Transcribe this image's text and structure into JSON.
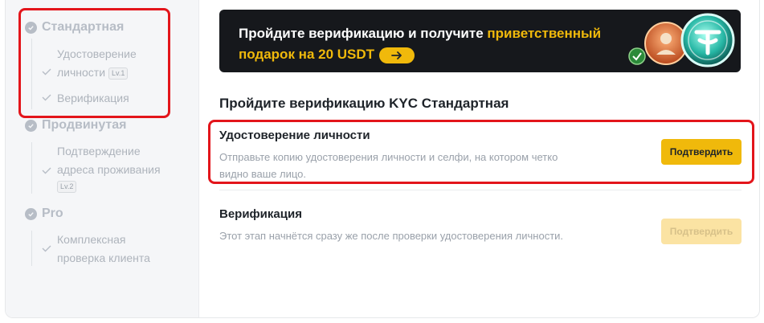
{
  "sidebar": {
    "levels": [
      {
        "label": "Стандартная",
        "steps": [
          {
            "label_line1": "Удостоверение",
            "label_line2": "личности",
            "badge": "Lv.1"
          },
          {
            "label_line1": "Верификация"
          }
        ]
      },
      {
        "label": "Продвинутая",
        "steps": [
          {
            "label_line1": "Подтверждение",
            "label_line2": "адреса проживания",
            "badge": "Lv.2"
          }
        ]
      },
      {
        "label": "Pro",
        "steps": [
          {
            "label_line1": "Комплексная",
            "label_line2": "проверка клиента"
          }
        ]
      }
    ]
  },
  "banner": {
    "text_part1": "Пройдите верификацию и получите ",
    "text_highlight": "приветственный подарок на 20 USDT",
    "arrow_icon": "arrow-right-icon"
  },
  "main": {
    "heading": "Пройдите верификацию KYC Стандартная",
    "steps": [
      {
        "title": "Удостоверение личности",
        "description": "Отправьте копию удостоверения личности и селфи, на котором четко видно ваше лицо.",
        "button": "Подтвердить",
        "state": "active"
      },
      {
        "title": "Верификация",
        "description": "Этот этап начнётся сразу же после проверки удостоверения личности.",
        "button": "Подтвердить",
        "state": "disabled"
      }
    ]
  },
  "colors": {
    "accent": "#f0b90b",
    "highlight_border": "#e3151b",
    "muted_text": "#b7bdc6"
  }
}
